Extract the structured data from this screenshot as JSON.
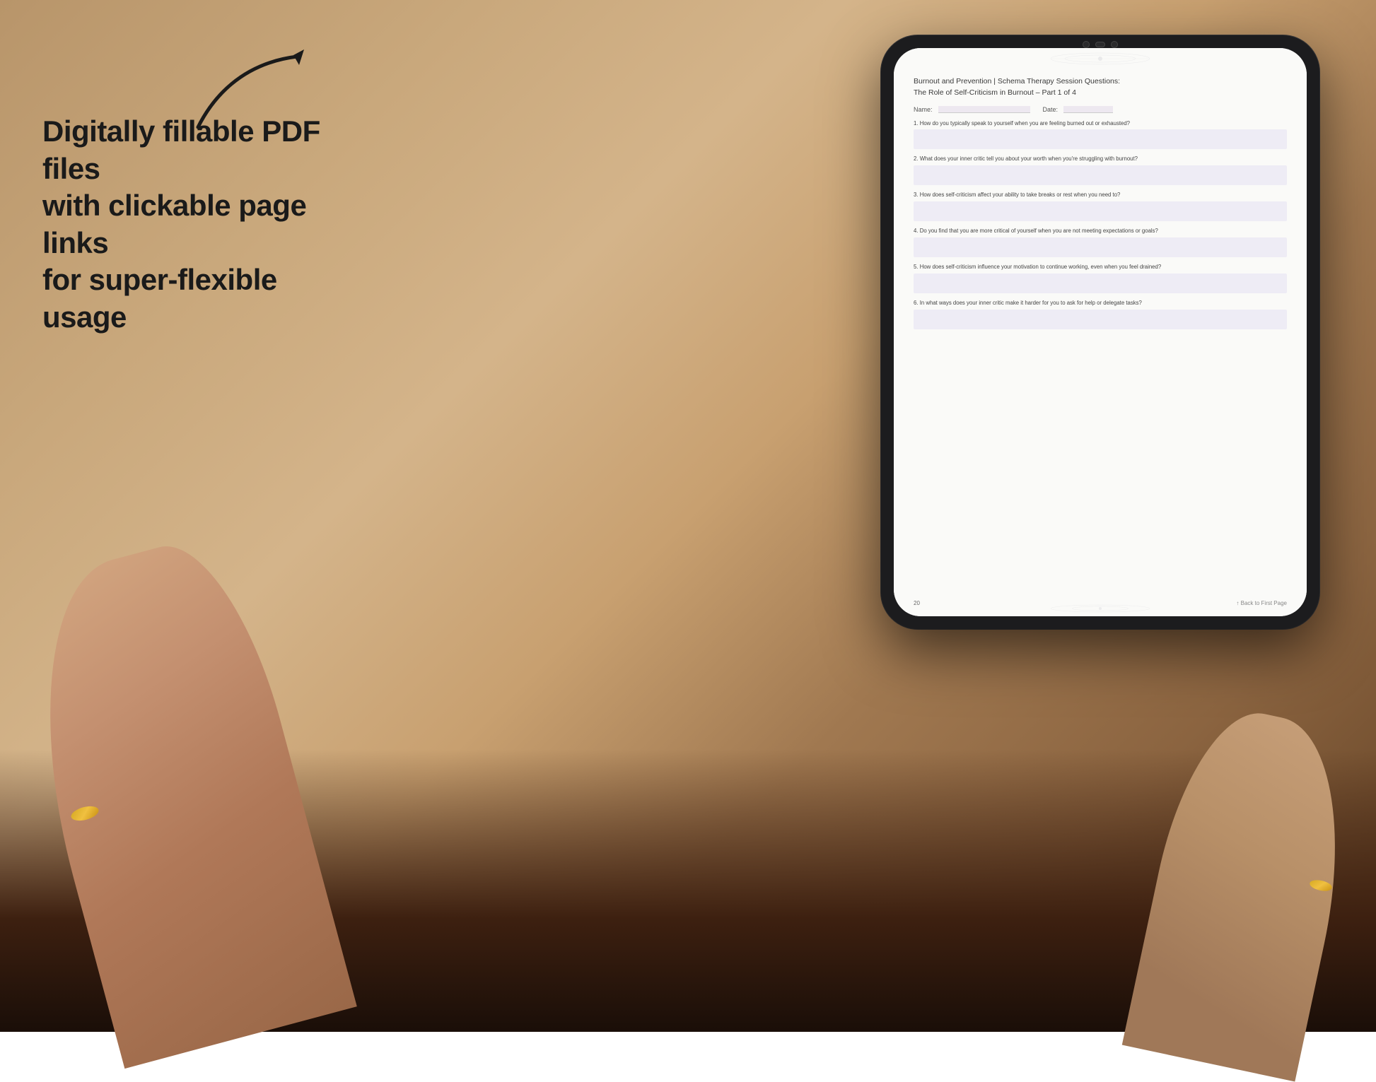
{
  "background": {
    "color_start": "#b8956a",
    "color_end": "#5c3c20"
  },
  "left_text": {
    "line1": "Digitally fillable PDF files",
    "line2": "with clickable page links",
    "line3": "for super-flexible usage"
  },
  "arrow": {
    "label": "arrow pointing right"
  },
  "tablet": {
    "title": "Tablet device"
  },
  "pdf": {
    "title_line1": "Burnout and Prevention | Schema Therapy Session Questions:",
    "title_line2": "The Role of Self-Criticism in Burnout  – Part 1 of 4",
    "name_label": "Name:",
    "date_label": "Date:",
    "questions": [
      {
        "number": "1.",
        "text": "How do you typically speak to yourself when you are feeling burned out or exhausted?"
      },
      {
        "number": "2.",
        "text": "What does your inner critic tell you about your worth when you're struggling with burnout?"
      },
      {
        "number": "3.",
        "text": "How does self-criticism affect your ability to take breaks or rest when you need to?"
      },
      {
        "number": "4.",
        "text": "Do you find that you are more critical of yourself when you are not meeting expectations or goals?"
      },
      {
        "number": "5.",
        "text": "How does self-criticism influence your motivation to continue working, even when you feel drained?"
      },
      {
        "number": "6.",
        "text": "In what ways does your inner critic make it harder for you to ask for help or delegate tasks?"
      }
    ],
    "footer": {
      "page_number": "20",
      "back_link": "↑ Back to First Page"
    }
  }
}
